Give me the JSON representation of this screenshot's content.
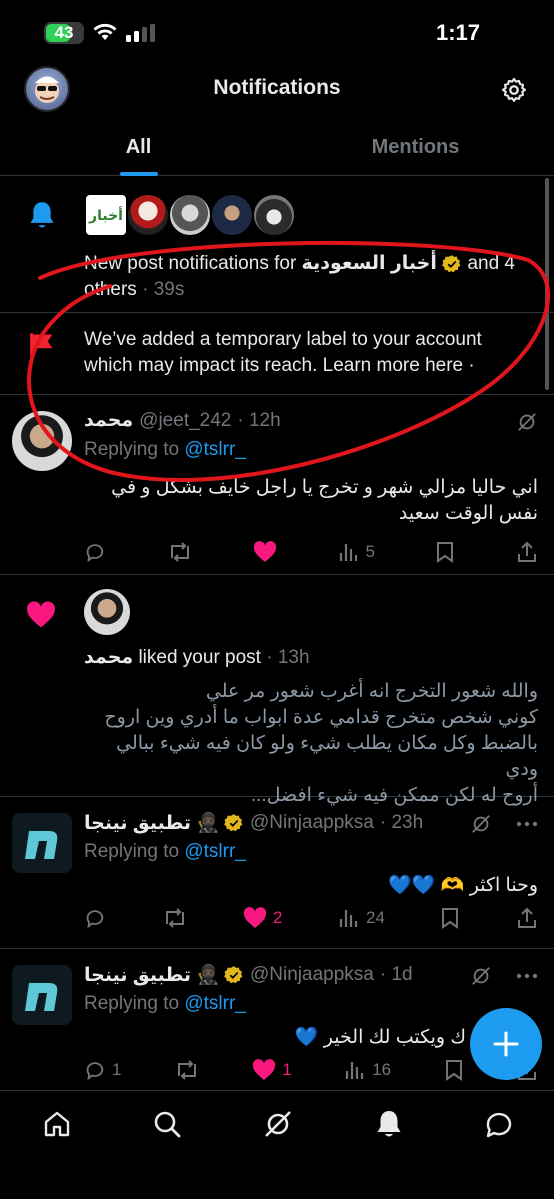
{
  "status": {
    "battery": "43",
    "time": "1:17",
    "colors": {
      "battery_fill": "#30d158"
    }
  },
  "header": {
    "title": "Notifications",
    "avatar_icon": "profile-avatar",
    "settings_icon": "gear-icon"
  },
  "tabs": [
    {
      "label": "All",
      "active": true
    },
    {
      "label": "Mentions",
      "active": false
    }
  ],
  "notif_new_posts": {
    "prefix": "New post notifications for ",
    "account": "أخبار السعودية",
    "suffix_1": " and 4",
    "suffix_2": "others",
    "time": " · 39s",
    "first_avatar_text": "أخبار"
  },
  "notif_label": {
    "line1": "We’ve added a temporary label to your account",
    "line2": "which may impact its reach. Learn more here ·"
  },
  "post1": {
    "name": "محمد",
    "handle": "@jeet_242",
    "time": "· 12h",
    "replying_prefix": "Replying to ",
    "replying_handle": "@tslrr_",
    "body1": "اني حاليا مزالي شهر و تخرج يا راجل خايف بشكل و في",
    "body2": "نفس الوقت سعيد",
    "views": "5"
  },
  "notif_like": {
    "name": "محمد",
    "action": " liked your post",
    "time": " · 13h",
    "l1": "والله شعور التخرج انه أغرب شعور مر علي",
    "l2": "كوني شخص متخرج قدامي عدة ابواب ما أدري وين اروح",
    "l3": "بالضبط وكل مكان يطلب شيء ولو كان فيه شيء ببالي ودي",
    "l4": "أروح له لكن ممكن فيه شيء افضل..."
  },
  "post2": {
    "name": "تطبيق نينجا 🥷🏿",
    "handle": "@Ninjaappksa",
    "time": "· 23h",
    "replying_prefix": "Replying to ",
    "replying_handle": "@tslrr_",
    "body": "وحنا اكثر 🫶 💙💙",
    "likes": "2",
    "views": "24"
  },
  "post3": {
    "name": "تطبيق نينجا 🥷🏿",
    "handle": "@Ninjaappksa",
    "time": "· 1d",
    "replying_prefix": "Replying to ",
    "replying_handle": "@tslrr_",
    "body": "ك ويكتب لك الخير 💙",
    "replies": "1",
    "likes": "1",
    "views": "16"
  },
  "fab": {
    "icon": "plus-icon",
    "color": "#1d9bf0"
  },
  "tabbar": [
    "home-icon",
    "search-icon",
    "grok-icon",
    "notifications-icon",
    "messages-icon"
  ],
  "colors": {
    "accent": "#1d9bf0",
    "like": "#f91880",
    "annotation": "#e0161c"
  }
}
